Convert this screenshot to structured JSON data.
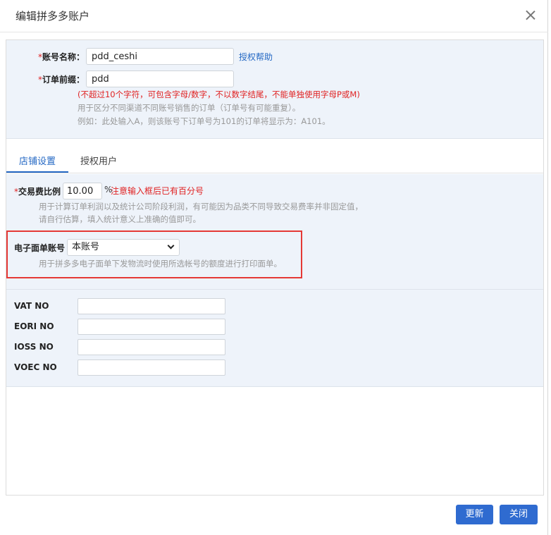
{
  "dialog": {
    "title": "编辑拼多多账户"
  },
  "account": {
    "name_label": "账号名称：",
    "name_value": "pdd_ceshi",
    "auth_help_link": "授权帮助",
    "prefix_label": "订单前缀：",
    "prefix_value": "pdd",
    "prefix_rule": "(不超过10个字符，可包含字母/数字，不以数字结尾，不能单独使用字母P或M)",
    "prefix_hint_1": "用于区分不同渠道不同账号销售的订单（订单号有可能重复）。",
    "prefix_hint_2": "例如：此处输入A，则该账号下订单号为101的订单将显示为：A101。"
  },
  "tabs": [
    {
      "label": "店铺设置",
      "active": true
    },
    {
      "label": "授权用户",
      "active": false
    }
  ],
  "shop_settings": {
    "fee_label": "交易费比例",
    "fee_value": "10.00",
    "fee_unit": "%",
    "fee_warning": "注意输入框后已有百分号",
    "fee_hint_1": "用于计算订单利润以及统计公司阶段利润，有可能因为品类不同导致交易费率并非固定值，",
    "fee_hint_2": "请自行估算，填入统计意义上准确的值即可。",
    "eorder_label": "电子面单账号",
    "eorder_selected": "本账号",
    "eorder_hint": "用于拼多多电子面单下发物流时使用所选帐号的额度进行打印面单。"
  },
  "tax_fields": [
    {
      "label": "VAT NO",
      "value": ""
    },
    {
      "label": "EORI NO",
      "value": ""
    },
    {
      "label": "IOSS NO",
      "value": ""
    },
    {
      "label": "VOEC NO",
      "value": ""
    }
  ],
  "footer": {
    "update_label": "更新",
    "close_label": "关闭"
  },
  "colors": {
    "accent": "#2f6bd0",
    "link": "#2468c4",
    "warning": "#e02222",
    "panel_bg": "#eef3fa",
    "highlight": "#e53935"
  }
}
